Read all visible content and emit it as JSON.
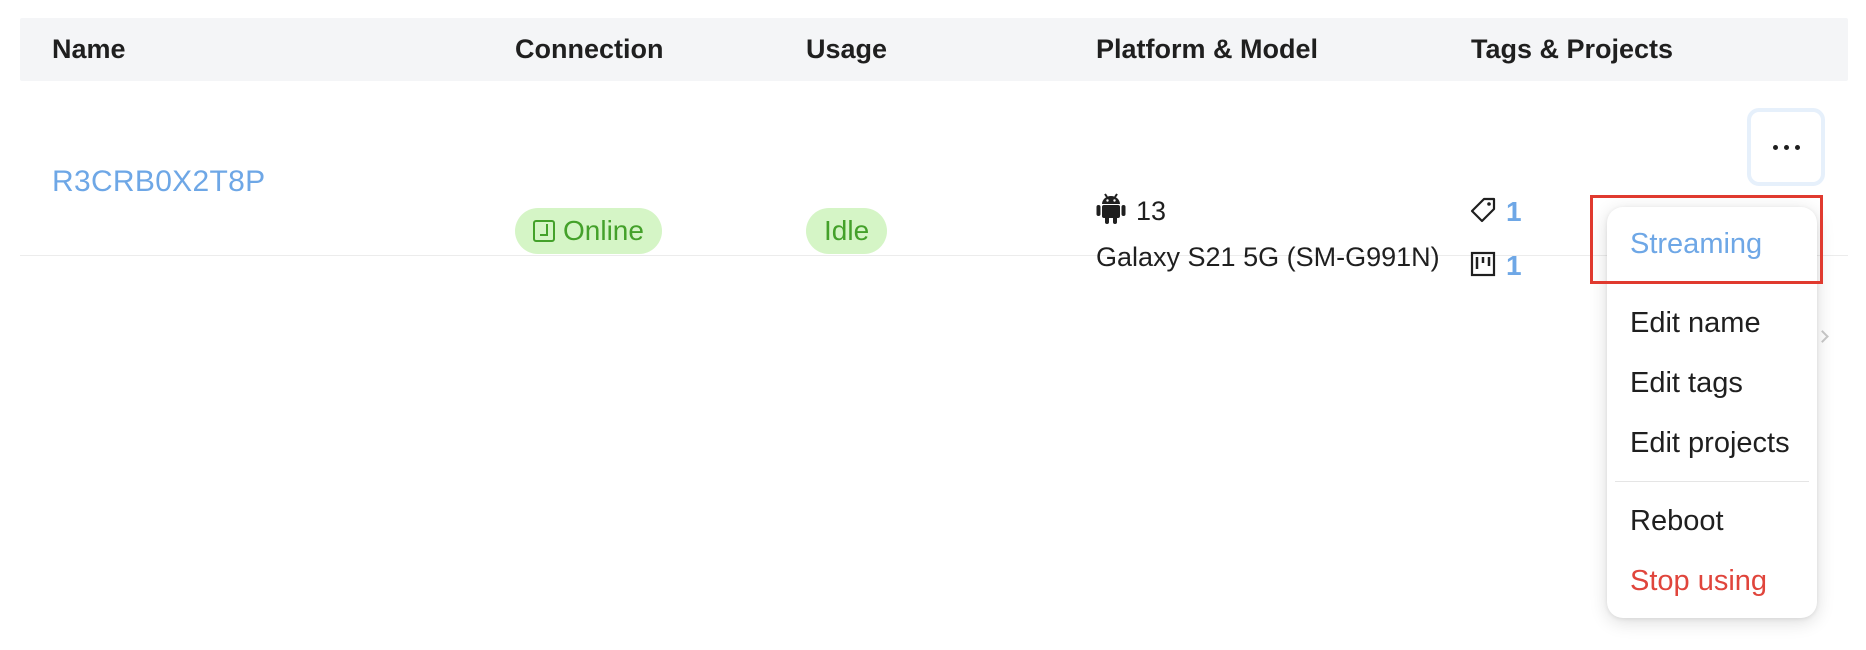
{
  "table": {
    "headers": {
      "name": "Name",
      "connection": "Connection",
      "usage": "Usage",
      "platform": "Platform & Model",
      "tags": "Tags & Projects"
    },
    "rows": [
      {
        "name": "R3CRB0X2T8P",
        "connection": "Online",
        "usage": "Idle",
        "platform_icon": "android-icon",
        "os_version": "13",
        "model": "Galaxy S21 5G (SM-G991N)",
        "tag_count": "1",
        "project_count": "1"
      }
    ]
  },
  "menu": {
    "streaming": "Streaming",
    "edit_name": "Edit name",
    "edit_tags": "Edit tags",
    "edit_projects": "Edit projects",
    "reboot": "Reboot",
    "stop_using": "Stop using"
  },
  "colors": {
    "link": "#6ea7e6",
    "badge_bg": "#d5f5c6",
    "badge_text": "#44a12a",
    "danger": "#e0453c",
    "highlight": "#e03a2f",
    "header_bg": "#f4f5f7"
  }
}
